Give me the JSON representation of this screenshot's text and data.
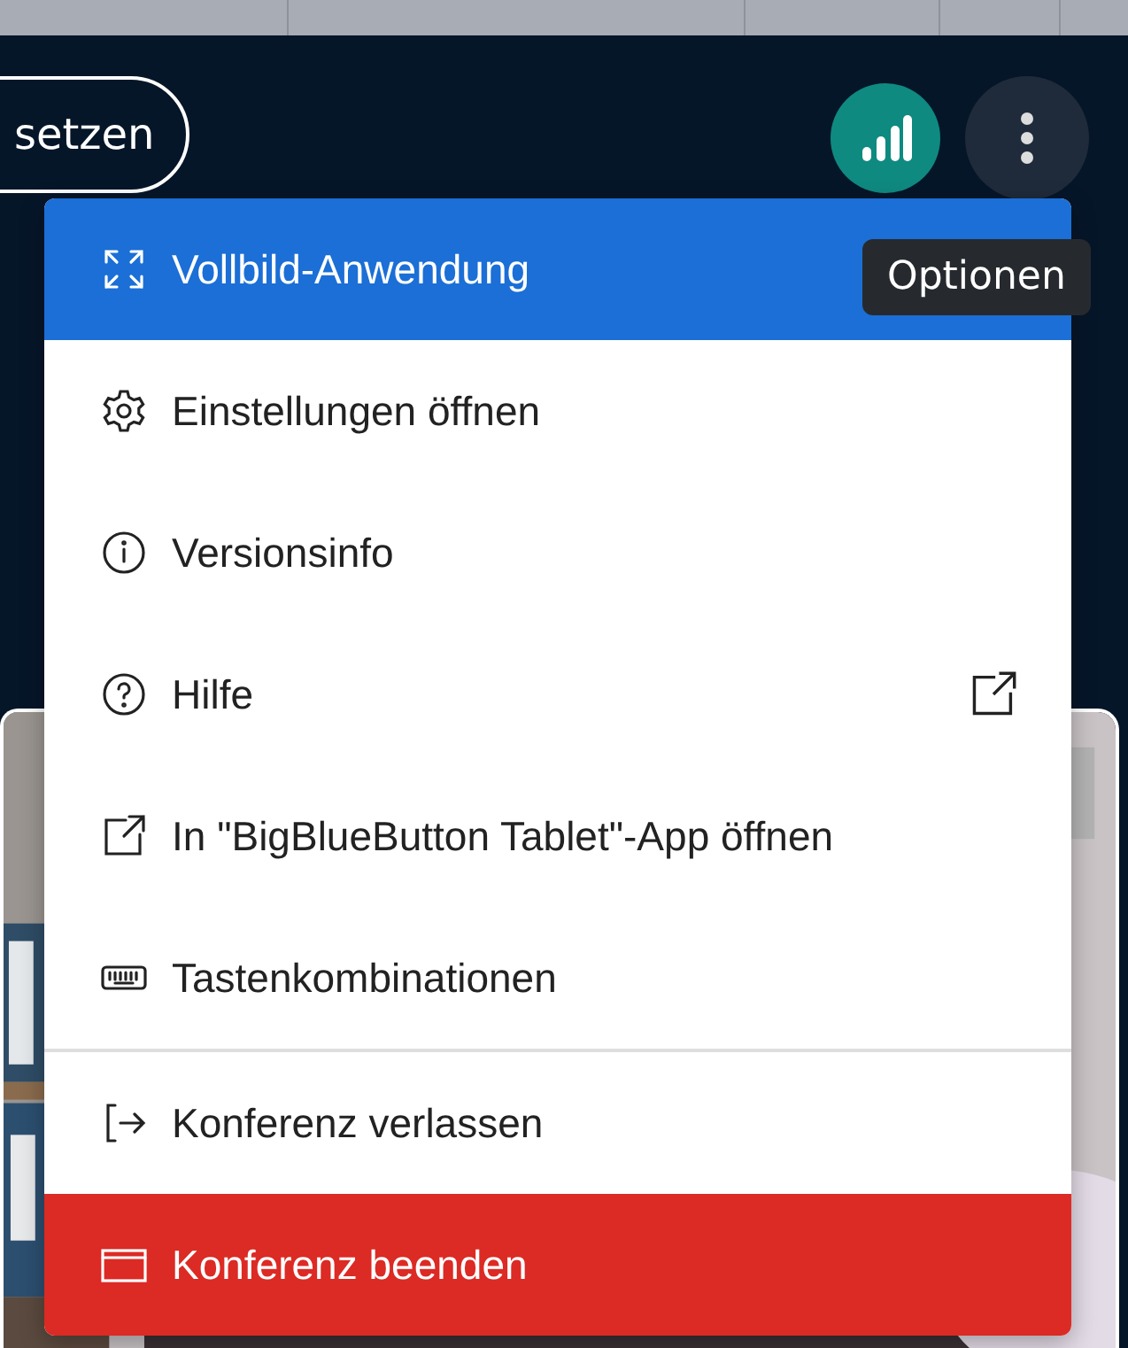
{
  "header": {
    "partial_button": "setzen",
    "tooltip": "Optionen"
  },
  "menu": {
    "groups": [
      [
        {
          "label": "Vollbild-Anwendung",
          "kind": "normal",
          "selected": true,
          "external": false
        },
        {
          "label": "Einstellungen öffnen",
          "kind": "normal",
          "selected": false,
          "external": false
        },
        {
          "label": "Versionsinfo",
          "kind": "normal",
          "selected": false,
          "external": false
        },
        {
          "label": "Hilfe",
          "kind": "normal",
          "selected": false,
          "external": true
        },
        {
          "label": "In \"BigBlueButton Tablet\"-App öffnen",
          "kind": "normal",
          "selected": false,
          "external": false
        },
        {
          "label": "Tastenkombinationen",
          "kind": "normal",
          "selected": false,
          "external": false
        }
      ],
      [
        {
          "label": "Konferenz verlassen",
          "kind": "normal",
          "selected": false,
          "external": false
        },
        {
          "label": "Konferenz beenden",
          "kind": "danger",
          "selected": false,
          "external": false
        }
      ]
    ]
  }
}
